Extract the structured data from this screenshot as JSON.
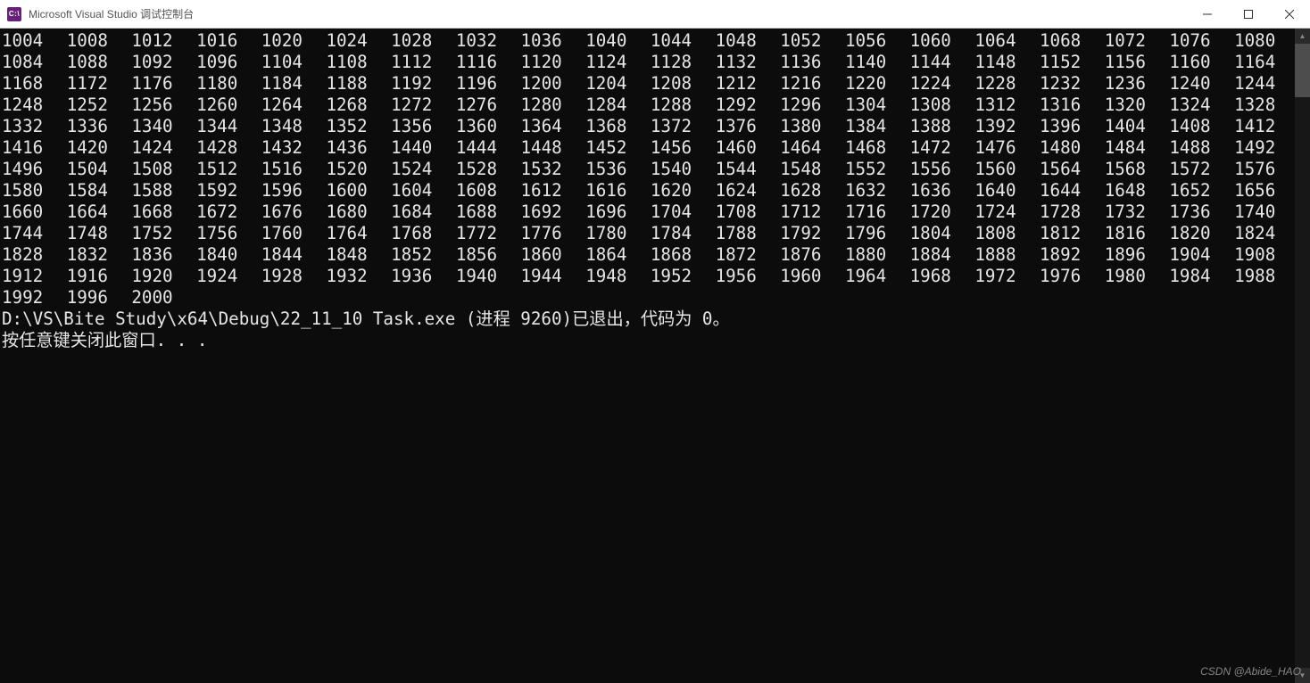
{
  "window": {
    "title": "Microsoft Visual Studio 调试控制台",
    "icon_label": "C:\\"
  },
  "console": {
    "numbers": [
      [
        1004,
        1008,
        1012,
        1016,
        1020,
        1024,
        1028,
        1032,
        1036,
        1040,
        1044,
        1048,
        1052,
        1056,
        1060,
        1064,
        1068,
        1072,
        1076,
        1080
      ],
      [
        1084,
        1088,
        1092,
        1096,
        1104,
        1108,
        1112,
        1116,
        1120,
        1124,
        1128,
        1132,
        1136,
        1140,
        1144,
        1148,
        1152,
        1156,
        1160,
        1164
      ],
      [
        1168,
        1172,
        1176,
        1180,
        1184,
        1188,
        1192,
        1196,
        1200,
        1204,
        1208,
        1212,
        1216,
        1220,
        1224,
        1228,
        1232,
        1236,
        1240,
        1244
      ],
      [
        1248,
        1252,
        1256,
        1260,
        1264,
        1268,
        1272,
        1276,
        1280,
        1284,
        1288,
        1292,
        1296,
        1304,
        1308,
        1312,
        1316,
        1320,
        1324,
        1328
      ],
      [
        1332,
        1336,
        1340,
        1344,
        1348,
        1352,
        1356,
        1360,
        1364,
        1368,
        1372,
        1376,
        1380,
        1384,
        1388,
        1392,
        1396,
        1404,
        1408,
        1412
      ],
      [
        1416,
        1420,
        1424,
        1428,
        1432,
        1436,
        1440,
        1444,
        1448,
        1452,
        1456,
        1460,
        1464,
        1468,
        1472,
        1476,
        1480,
        1484,
        1488,
        1492
      ],
      [
        1496,
        1504,
        1508,
        1512,
        1516,
        1520,
        1524,
        1528,
        1532,
        1536,
        1540,
        1544,
        1548,
        1552,
        1556,
        1560,
        1564,
        1568,
        1572,
        1576
      ],
      [
        1580,
        1584,
        1588,
        1592,
        1596,
        1600,
        1604,
        1608,
        1612,
        1616,
        1620,
        1624,
        1628,
        1632,
        1636,
        1640,
        1644,
        1648,
        1652,
        1656
      ],
      [
        1660,
        1664,
        1668,
        1672,
        1676,
        1680,
        1684,
        1688,
        1692,
        1696,
        1704,
        1708,
        1712,
        1716,
        1720,
        1724,
        1728,
        1732,
        1736,
        1740
      ],
      [
        1744,
        1748,
        1752,
        1756,
        1760,
        1764,
        1768,
        1772,
        1776,
        1780,
        1784,
        1788,
        1792,
        1796,
        1804,
        1808,
        1812,
        1816,
        1820,
        1824
      ],
      [
        1828,
        1832,
        1836,
        1840,
        1844,
        1848,
        1852,
        1856,
        1860,
        1864,
        1868,
        1872,
        1876,
        1880,
        1884,
        1888,
        1892,
        1896,
        1904,
        1908
      ],
      [
        1912,
        1916,
        1920,
        1924,
        1928,
        1932,
        1936,
        1940,
        1944,
        1948,
        1952,
        1956,
        1960,
        1964,
        1968,
        1972,
        1976,
        1980,
        1984,
        1988
      ],
      [
        1992,
        1996,
        2000
      ]
    ],
    "exit_line": "D:\\VS\\Bite Study\\x64\\Debug\\22_11_10 Task.exe (进程 9260)已退出，代码为 0。",
    "prompt_line": "按任意键关闭此窗口. . ."
  },
  "watermark": "CSDN @Abide_HAO"
}
